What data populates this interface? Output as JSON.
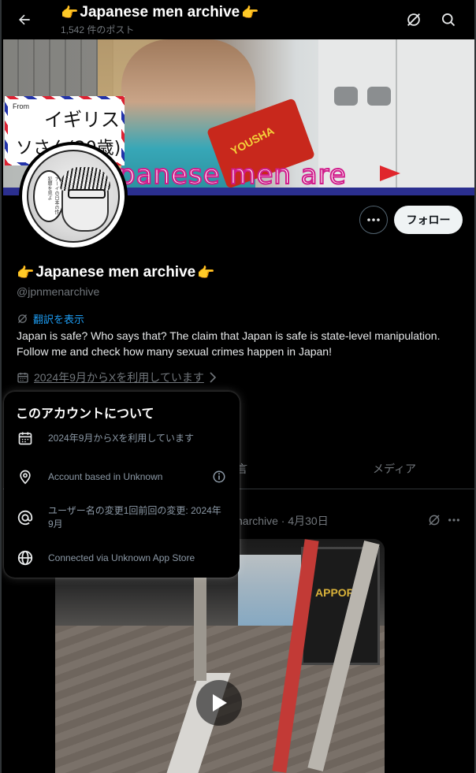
{
  "header": {
    "title": "Japanese men archive",
    "post_count": "1,542 件のポスト"
  },
  "banner": {
    "sign_from": "From",
    "sign_line1": "イギリス",
    "sign_line2": "ソさん(20歳)",
    "mic_label": "YOUSHA",
    "caption": "panese men are"
  },
  "avatar": {
    "bubble_text": "アーイの日本の性犯罪を見よ"
  },
  "profile": {
    "name": "Japanese men archive",
    "handle": "@jpnmenarchive",
    "translate_label": "翻訳を表示",
    "bio": "Japan is safe? Who says that? The claim that Japan is safe is state-level manipulation. Follow me and check how many sexual crimes happen in Japan!",
    "joined": "2024年9月からXを利用しています",
    "follow_label": "フォロー"
  },
  "tabs": {
    "partial_label": "言",
    "media_label": "メディア"
  },
  "post": {
    "meta": "narchive · 4月30日",
    "media_sign": "APPORO"
  },
  "about_popover": {
    "title": "このアカウントについて",
    "rows": [
      {
        "icon": "calendar-icon",
        "label": "2024年9月からXを利用しています"
      },
      {
        "icon": "location-icon",
        "label": "Account based in Unknown"
      },
      {
        "icon": "at-icon",
        "label": "ユーザー名の変更1回前回の変更: 2024年9月"
      },
      {
        "icon": "globe-icon",
        "label": "Connected via Unknown App Store"
      }
    ]
  },
  "colors": {
    "accent": "#1d9bf0",
    "muted": "#71767b",
    "background": "#000000",
    "follow_bg": "#eff3f4"
  }
}
